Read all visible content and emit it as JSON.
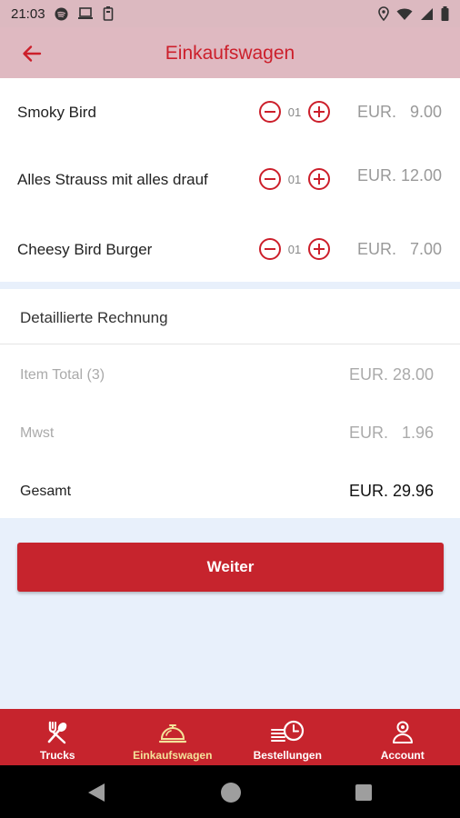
{
  "status_bar": {
    "time": "21:03"
  },
  "app_bar": {
    "title": "Einkaufswagen",
    "back_icon": "arrow-left-icon"
  },
  "cart": {
    "items": [
      {
        "name": "Smoky Bird",
        "qty": "01",
        "price": "EUR.   9.00"
      },
      {
        "name": "Alles Strauss mit alles drauf",
        "qty": "01",
        "price": "EUR. 12.00"
      },
      {
        "name": "Cheesy Bird Burger",
        "qty": "01",
        "price": "EUR.   7.00"
      }
    ]
  },
  "bill": {
    "heading": "Detaillierte Rechnung",
    "item_total_label": "Item Total (3)",
    "item_total_value": "EUR. 28.00",
    "mwst_label": "Mwst",
    "mwst_value": "EUR.   1.96",
    "total_label": "Gesamt",
    "total_value": "EUR. 29.96"
  },
  "continue_button": "Weiter",
  "bottom_nav": [
    {
      "label": "Trucks",
      "icon": "fork-spoon-icon"
    },
    {
      "label": "Einkaufswagen",
      "icon": "service-bell-icon",
      "active": true
    },
    {
      "label": "Bestellungen",
      "icon": "list-clock-icon"
    },
    {
      "label": "Account",
      "icon": "user-icon"
    }
  ],
  "colors": {
    "accent": "#cc1f2b",
    "appbar_bg": "#dfb9c1",
    "active_nav": "#f4e39a"
  }
}
